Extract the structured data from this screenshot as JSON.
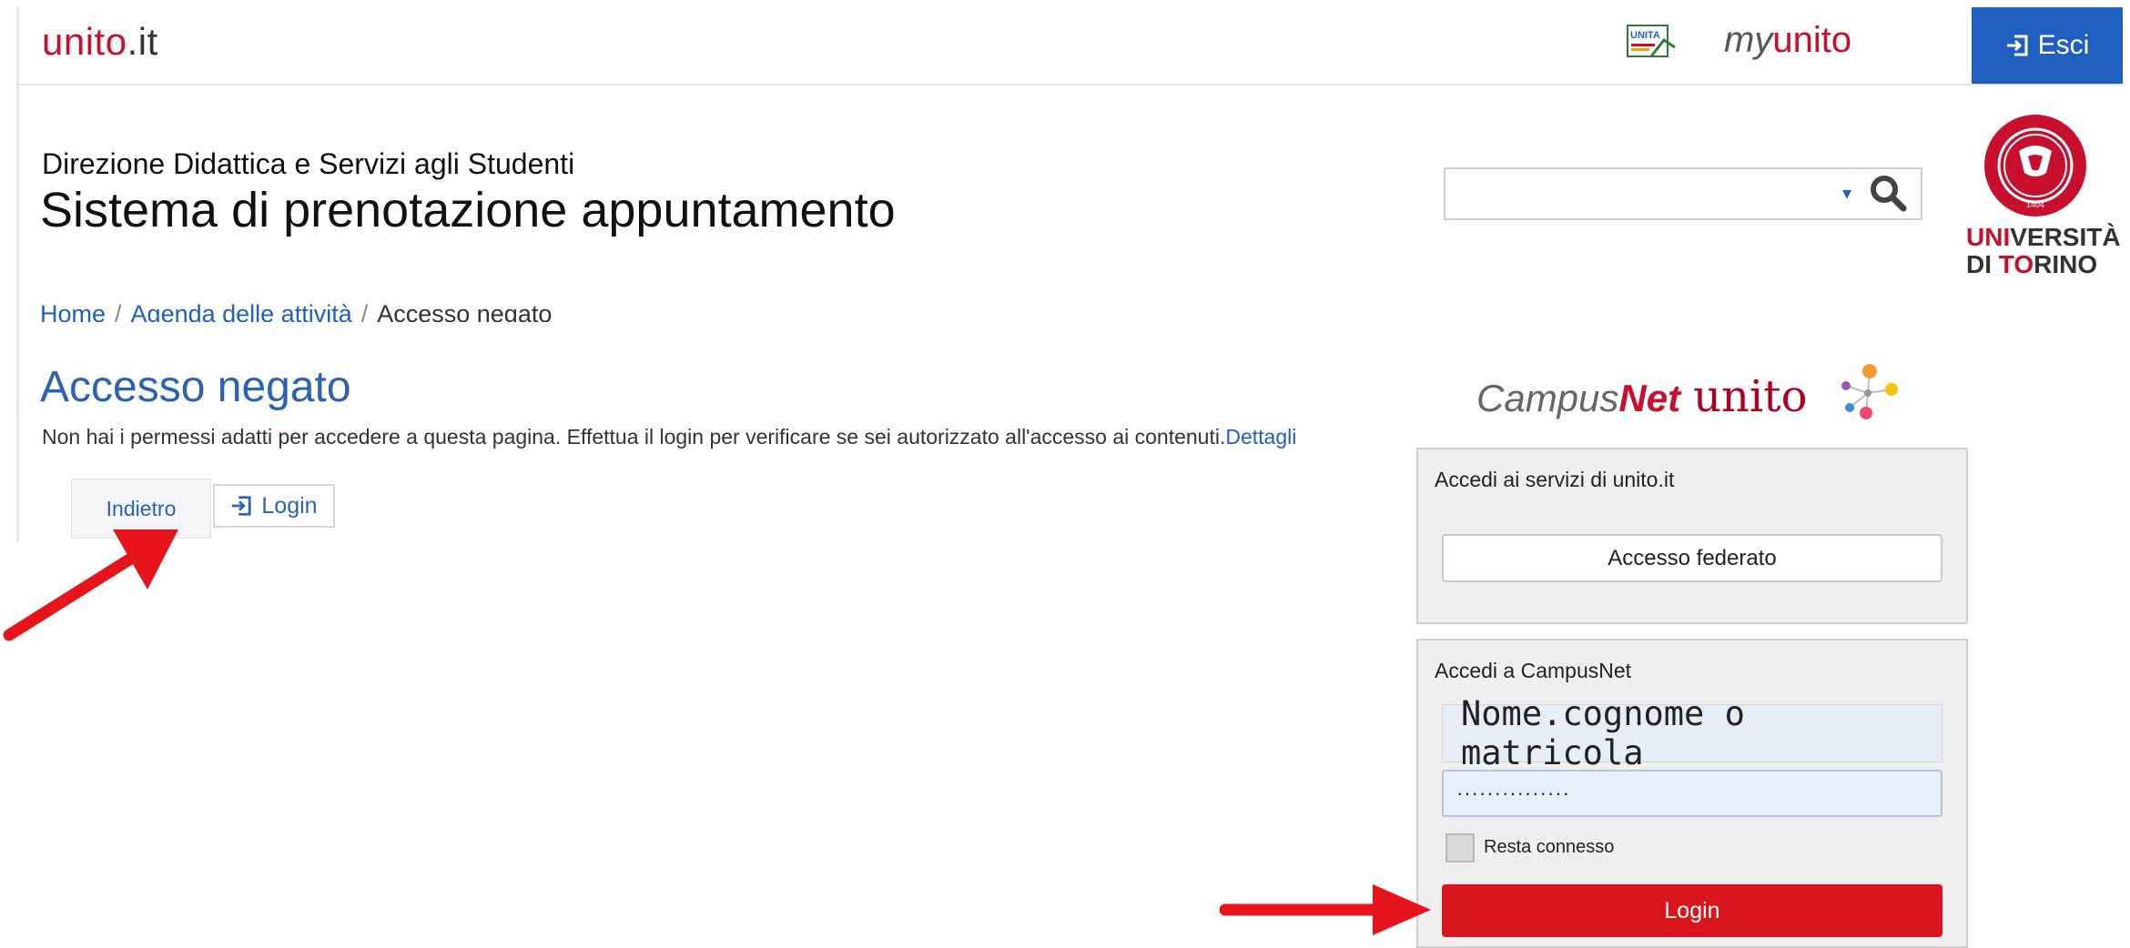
{
  "topbar": {
    "brand_main": "unito",
    "brand_tld": ".it",
    "unita_logo_text": "UNITA",
    "myunito_prefix": "my",
    "myunito_suffix": "unito",
    "exit_label": "Esci"
  },
  "header": {
    "department": "Direzione Didattica e Servizi agli Studenti",
    "system_title": "Sistema di prenotazione appuntamento",
    "search": {
      "value": "",
      "placeholder": ""
    },
    "logo_line1_red": "UNI",
    "logo_line1": "VERSITÀ",
    "logo_line2_a": "DI ",
    "logo_line2_red": "TO",
    "logo_line2_b": "RINO",
    "seal_year": "1404"
  },
  "breadcrumb": {
    "items": [
      "Home",
      "Agenda delle attività",
      "Accesso negato"
    ],
    "separator": "/"
  },
  "main": {
    "title": "Accesso negato",
    "message": "Non hai i permessi adatti per accedere a questa pagina. Effettua il login per verificare se sei autorizzato all'accesso ai contenuti.",
    "details_link": "Dettagli",
    "back_button": "Indietro",
    "login_button": "Login"
  },
  "campusnet": {
    "logo_a": "Campus",
    "logo_b": "Net",
    "logo_c": "unito",
    "federated_panel_title": "Accedi ai servizi di unito.it",
    "federated_button": "Accesso federato",
    "login_panel_title": "Accedi a CampusNet",
    "username_value": "Nome.cognome o matricola",
    "password_value": "···············",
    "remember_label": "Resta connesso",
    "login_button": "Login"
  },
  "colors": {
    "brand_red": "#c8102e",
    "link_blue": "#1f5fbf",
    "login_red": "#d8161b",
    "annotation_arrow": "#e8141b"
  }
}
